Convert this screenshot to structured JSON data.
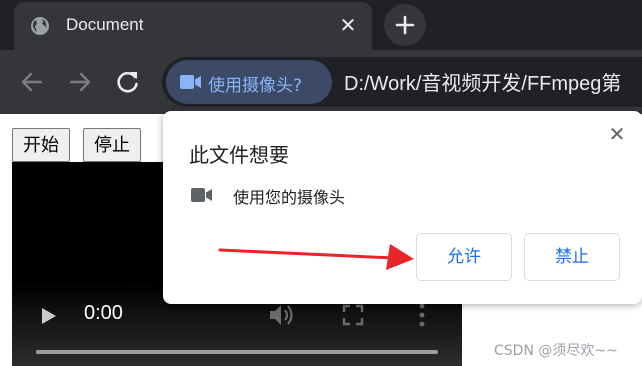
{
  "browser": {
    "tab": {
      "title": "Document",
      "close_glyph": "✕",
      "favicon": "globe-icon"
    },
    "new_tab_icon": "plus-icon",
    "toolbar": {
      "back_icon": "arrow-left-icon",
      "forward_icon": "arrow-right-icon",
      "reload_icon": "reload-icon",
      "permission_chip": {
        "icon": "camera-icon",
        "label": "使用摄像头?"
      },
      "url": "D:/Work/音视频开发/FFmpeg第"
    }
  },
  "page": {
    "buttons": {
      "start": "开始",
      "stop": "停止"
    },
    "video": {
      "time": "0:00",
      "progress": 0
    }
  },
  "popup": {
    "title": "此文件想要",
    "close_glyph": "✕",
    "permission": {
      "icon": "camera-icon",
      "text": "使用您的摄像头"
    },
    "allow_label": "允许",
    "block_label": "禁止"
  },
  "annotation": {
    "arrow_color": "#e8252b"
  },
  "watermark": "CSDN @须尽欢~~",
  "colors": {
    "accent": "#1a73e8",
    "chip_text": "#8ab4f8",
    "chrome_dark": "#202124",
    "chrome_mid": "#35363a"
  }
}
